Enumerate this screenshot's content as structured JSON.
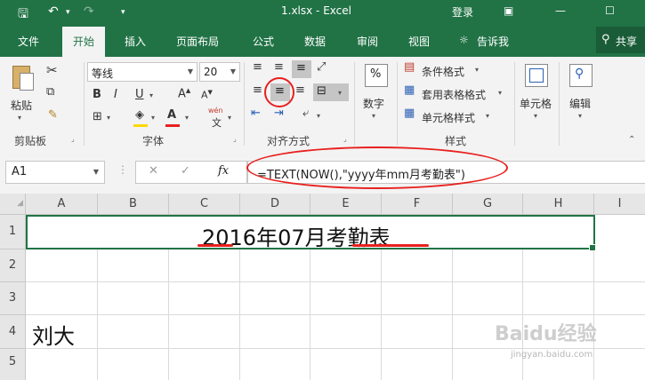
{
  "titlebar": {
    "save_icon": "save-icon",
    "undo_icon": "undo-icon",
    "redo_icon": "redo-icon",
    "filename": "1.xlsx - Excel",
    "login": "登录",
    "minimize": "—",
    "restore": "☐",
    "ribbon_display": "▣"
  },
  "tabs": [
    "文件",
    "开始",
    "插入",
    "页面布局",
    "公式",
    "数据",
    "审阅",
    "视图"
  ],
  "tell_me": "告诉我",
  "share": "共享",
  "ribbon": {
    "clipboard": {
      "paste": "粘贴",
      "label": "剪贴板"
    },
    "font": {
      "name": "等线",
      "size": "20",
      "bold": "B",
      "italic": "I",
      "underline": "U",
      "label": "字体",
      "phonetic": "wén"
    },
    "alignment": {
      "label": "对齐方式"
    },
    "number": {
      "label": "数字",
      "percent": "%"
    },
    "styles": {
      "conditional": "条件格式",
      "table": "套用表格格式",
      "cell": "单元格样式",
      "label": "样式"
    },
    "cells": {
      "label": "单元格"
    },
    "editing": {
      "label": "编辑"
    }
  },
  "formula_bar": {
    "name_box": "A1",
    "cancel": "✕",
    "enter": "✓",
    "fx": "fx",
    "formula": "=TEXT(NOW(),\"yyyy年mm月考勤表\")"
  },
  "sheet": {
    "columns": [
      "A",
      "B",
      "C",
      "D",
      "E",
      "F",
      "G",
      "H",
      "I"
    ],
    "rows": [
      "1",
      "2",
      "3",
      "4",
      "5"
    ],
    "title_cell": "2016年07月考勤表",
    "a4": "刘大"
  },
  "watermark": {
    "logo": "Baidu经验",
    "url": "jingyan.baidu.com"
  },
  "colors": {
    "excel_green": "#217346",
    "annotation_red": "#e8201e",
    "selection": "#217346"
  }
}
